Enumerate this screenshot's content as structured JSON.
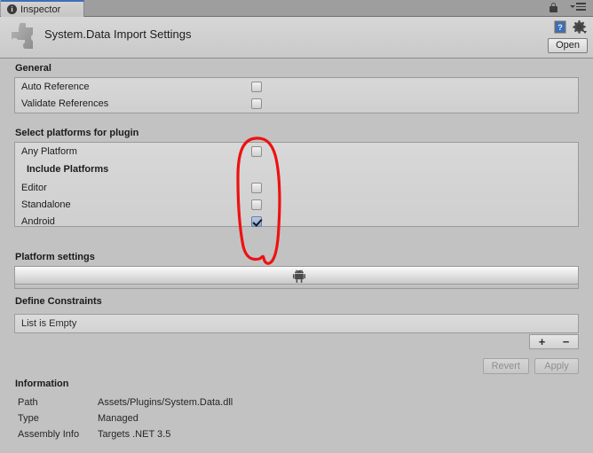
{
  "window": {
    "tab_label": "Inspector",
    "tab_icon": "info-icon",
    "lock_icon": "lock-icon",
    "menu_icon": "hamburger-menu-icon"
  },
  "header": {
    "asset_icon": "puzzle-piece-icon",
    "title": "System.Data Import Settings",
    "help_icon": "help-book-icon",
    "gear_icon": "gear-icon",
    "open_label": "Open"
  },
  "general": {
    "title": "General",
    "rows": [
      {
        "label": "Auto Reference",
        "checked": false
      },
      {
        "label": "Validate References",
        "checked": false
      }
    ]
  },
  "platforms": {
    "title": "Select platforms for plugin",
    "any_platform": {
      "label": "Any Platform",
      "checked": false
    },
    "include_title": "Include Platforms",
    "rows": [
      {
        "label": "Editor",
        "checked": false
      },
      {
        "label": "Standalone",
        "checked": false
      },
      {
        "label": "Android",
        "checked": true
      }
    ]
  },
  "platform_settings": {
    "title": "Platform settings",
    "active_tab_icon": "android-robot-icon"
  },
  "define_constraints": {
    "title": "Define Constraints",
    "empty_text": "List is Empty",
    "add_label": "+",
    "remove_label": "−"
  },
  "actions": {
    "revert_label": "Revert",
    "apply_label": "Apply"
  },
  "information": {
    "title": "Information",
    "rows": [
      {
        "key": "Path",
        "value": "Assets/Plugins/System.Data.dll"
      },
      {
        "key": "Type",
        "value": "Managed"
      },
      {
        "key": "Assembly Info",
        "value": "Targets .NET 3.5"
      }
    ]
  },
  "annotation": {
    "shape": "hand-drawn-ellipse",
    "color": "#ee1111",
    "target": "platform-checkbox-column"
  }
}
